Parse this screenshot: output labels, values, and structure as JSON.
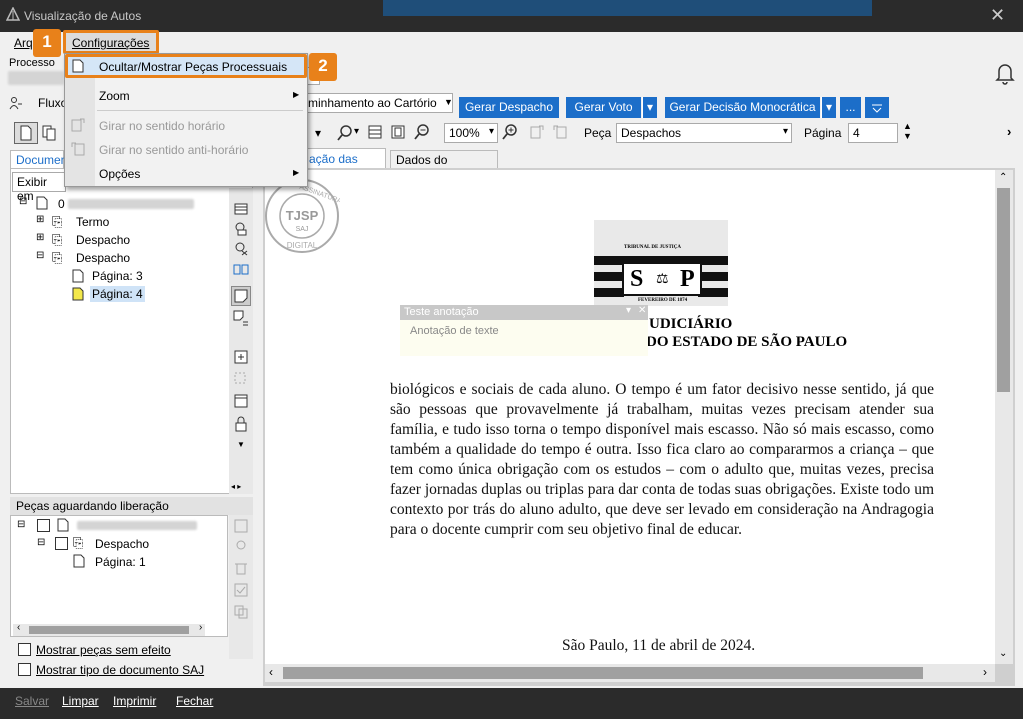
{
  "window": {
    "title": "Visualização de Autos",
    "close_glyph": "✕"
  },
  "menubar": {
    "arquivo": "Arq",
    "configuracoes": "Configurações"
  },
  "badges": {
    "one": "1",
    "two": "2"
  },
  "dropdown": {
    "items": [
      {
        "label": "Ocultar/Mostrar Peças Processuais",
        "enabled": true,
        "highlighted": true
      },
      {
        "label": "Zoom",
        "enabled": true,
        "submenu": true
      },
      {
        "label": "Girar no sentido horário",
        "enabled": false
      },
      {
        "label": "Girar no sentido anti-horário",
        "enabled": false
      },
      {
        "label": "Opções",
        "enabled": true,
        "submenu": true
      }
    ]
  },
  "processo": {
    "label": "Processo"
  },
  "fluxo": {
    "label": "Fluxo",
    "select_value": "minhamento ao Cartório"
  },
  "buttons": {
    "gerar_despacho": "Gerar Despacho",
    "gerar_voto": "Gerar Voto",
    "gerar_decisao": "Gerar Decisão Monocrática",
    "more": "...",
    "dropdown_arrow": "▾"
  },
  "toolbar": {
    "zoom_value": "100%",
    "peca_label": "Peça",
    "peca_value": "Despachos",
    "pagina_label": "Página",
    "pagina_value": "4"
  },
  "tabs": {
    "documentos": "Documen",
    "visualizacao": "ação das peças",
    "dados": "Dados do processo"
  },
  "left_panel": {
    "filter_label": "Exibir em",
    "tree": [
      {
        "label": "0",
        "level": 0
      },
      {
        "label": "Termo",
        "level": 1
      },
      {
        "label": "Despacho",
        "level": 1
      },
      {
        "label": "Despacho",
        "level": 1
      },
      {
        "label": "Página: 3",
        "level": 2
      },
      {
        "label": "Página: 4",
        "level": 2,
        "selected": true
      }
    ]
  },
  "pending_panel": {
    "title": "Peças aguardando liberação",
    "tree": [
      {
        "label": "Despacho",
        "level": 1
      },
      {
        "label": "Página: 1",
        "level": 2
      }
    ],
    "checkbox_sem_efeito": "Mostrar peças sem efeito",
    "checkbox_tipo_doc": "Mostrar tipo de documento SAJ"
  },
  "stamp": {
    "line1": "ASSINATURA",
    "center": "TJSP",
    "sub": "SAJ",
    "line2": "DIGITAL"
  },
  "letterhead": {
    "tribunal_small": "TRIBUNAL DE JUSTIÇA",
    "since": "FEVEREIRO DE 1874",
    "logo_s": "S",
    "logo_p": "P",
    "line1": "UDICIÁRIO",
    "line2": "DO ESTADO DE SÃO PAULO"
  },
  "annotation": {
    "title": "Teste anotação",
    "body": "Anotação de texte"
  },
  "document": {
    "paragraph": "biológicos e sociais de cada aluno. O tempo é um fator decisivo nesse sentido, já que são pessoas que provavelmente já trabalham, muitas vezes precisam atender sua família, e tudo isso torna o tempo disponível mais escasso. Não só mais escasso, como também a qualidade do tempo é outra. Isso fica claro ao compararmos a criança – que tem como única obrigação com os estudos – com o adulto que, muitas vezes, precisa fazer jornadas duplas ou triplas para dar conta de todas suas obrigações. Existe todo um contexto por trás do aluno adulto, que deve ser levado em consideração na Andragogia para o docente cumprir com seu objetivo final de educar.",
    "signature_date": "São Paulo, 11 de abril de 2024."
  },
  "footer": {
    "salvar": "Salvar",
    "limpar": "Limpar",
    "imprimir": "Imprimir",
    "fechar": "Fechar"
  },
  "colors": {
    "accent": "#1c6ec9",
    "highlight": "#e8811a",
    "titlebar": "#2b2b2b"
  }
}
